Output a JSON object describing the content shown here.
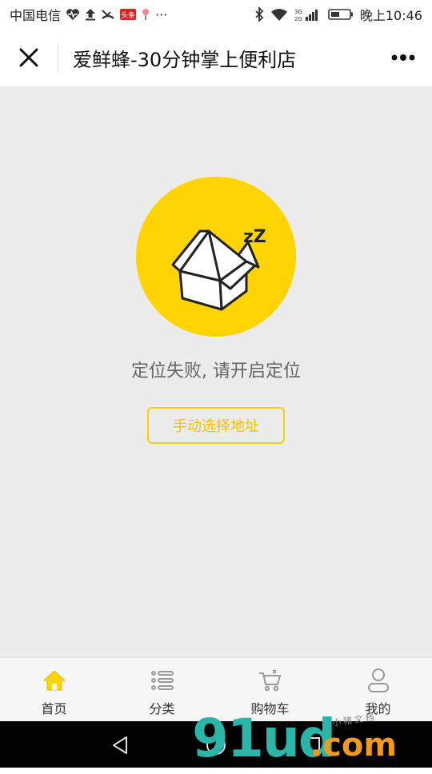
{
  "status_bar": {
    "carrier": "中国电信",
    "notification_badge": "头条",
    "more": "···",
    "network": "3G 2G",
    "time": "晚上10:46"
  },
  "header": {
    "title": "爱鲜蜂-30分钟掌上便利店"
  },
  "main": {
    "illustration_text": "zZ",
    "message": "定位失败, 请开启定位",
    "manual_button": "手动选择地址"
  },
  "tabbar": {
    "tabs": [
      {
        "label": "首页",
        "icon": "home-icon",
        "active": true
      },
      {
        "label": "分类",
        "icon": "list-icon",
        "active": false
      },
      {
        "label": "购物车",
        "icon": "cart-icon",
        "active": false
      },
      {
        "label": "我的",
        "icon": "user-icon",
        "active": false
      }
    ]
  },
  "watermark": {
    "main": "91ud",
    "suffix": ".com",
    "small": "小猪文档"
  },
  "colors": {
    "accent_yellow": "#ffd400",
    "button_border": "#f5cd1a",
    "background_gray": "#ececec",
    "watermark_teal": "#2ab5a8",
    "watermark_orange": "#f39a1e"
  }
}
